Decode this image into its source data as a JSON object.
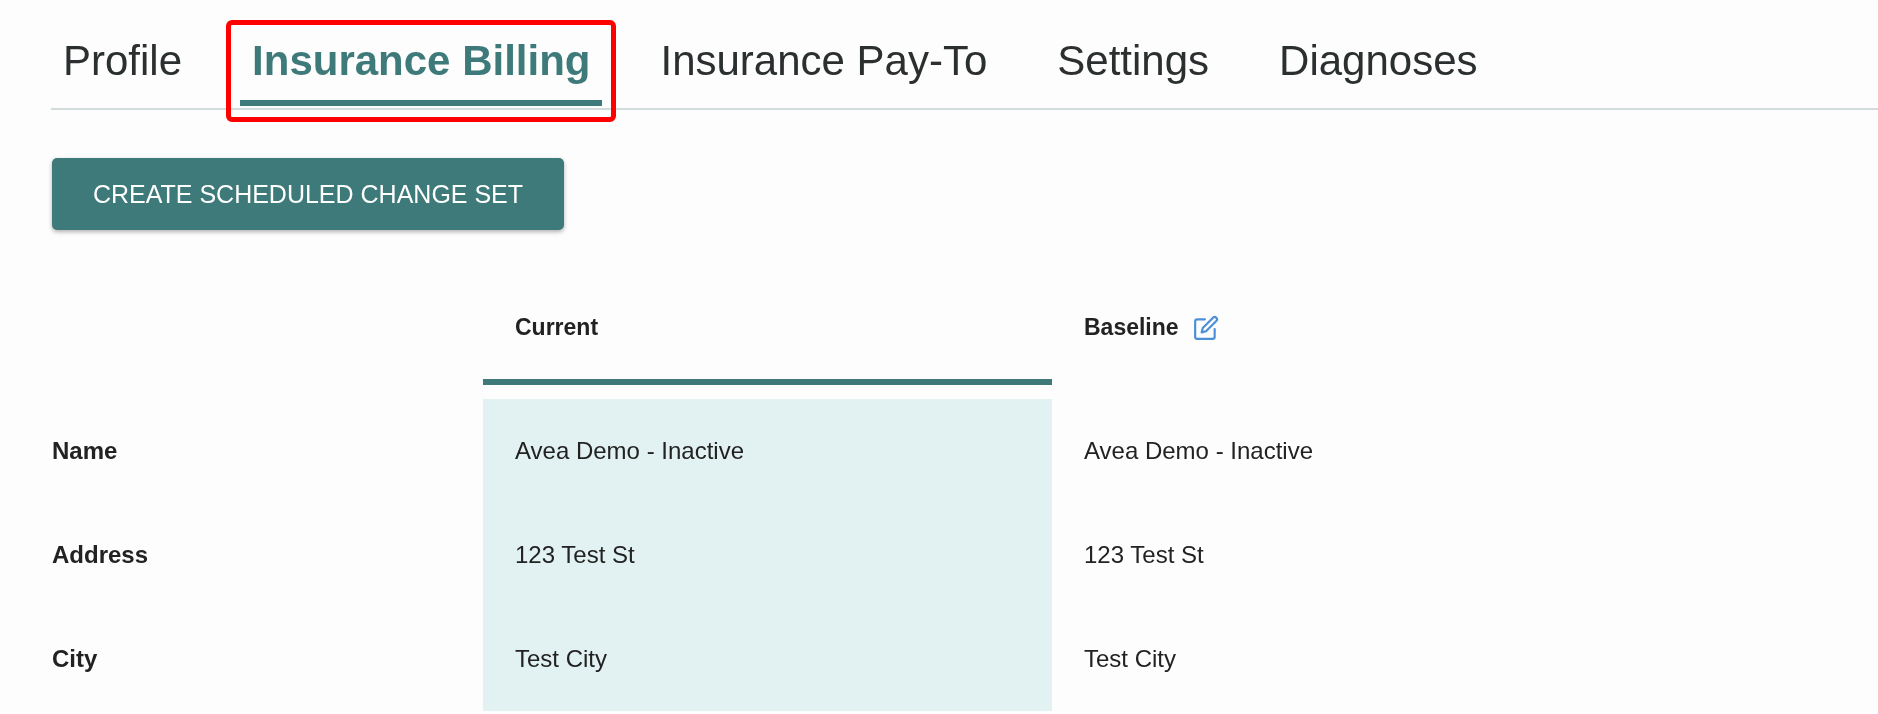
{
  "tabs": [
    {
      "label": "Profile",
      "selected": false,
      "highlighted": false
    },
    {
      "label": "Insurance Billing",
      "selected": true,
      "highlighted": true
    },
    {
      "label": "Insurance Pay-To",
      "selected": false,
      "highlighted": false
    },
    {
      "label": "Settings",
      "selected": false,
      "highlighted": false
    },
    {
      "label": "Diagnoses",
      "selected": false,
      "highlighted": false
    }
  ],
  "action_button": "CREATE SCHEDULED CHANGE SET",
  "table": {
    "columns": [
      {
        "label": "Current",
        "selected": true,
        "editable": false
      },
      {
        "label": "Baseline",
        "selected": false,
        "editable": true
      }
    ],
    "rows": [
      {
        "label": "Name",
        "values": [
          "Avea Demo - Inactive",
          "Avea Demo - Inactive"
        ]
      },
      {
        "label": "Address",
        "values": [
          "123 Test St",
          "123 Test St"
        ]
      },
      {
        "label": "City",
        "values": [
          "Test City",
          "Test City"
        ]
      }
    ]
  }
}
